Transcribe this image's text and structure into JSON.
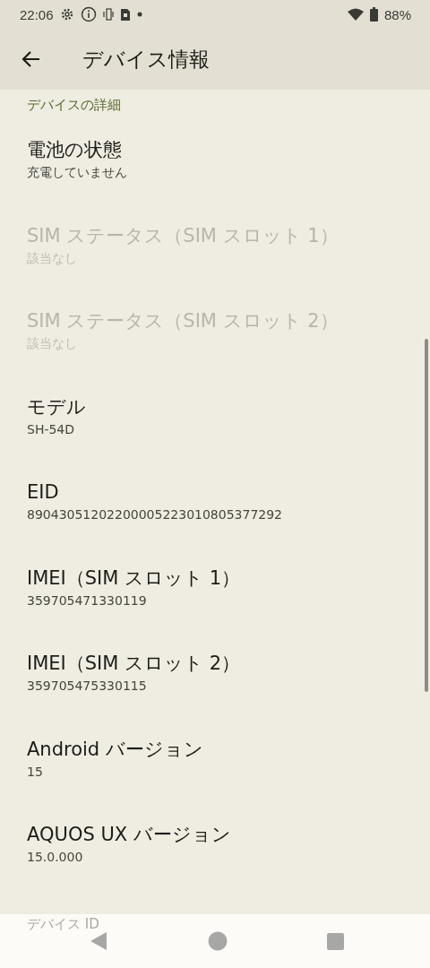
{
  "status_bar": {
    "time": "22:06",
    "battery": "88%"
  },
  "app_bar": {
    "title": "デバイス情報"
  },
  "section": {
    "title": "デバイスの詳細"
  },
  "items": [
    {
      "title": "電池の状態",
      "value": "充電していません",
      "disabled": false
    },
    {
      "title": "SIM ステータス（SIM スロット 1）",
      "value": "該当なし",
      "disabled": true
    },
    {
      "title": "SIM ステータス（SIM スロット 2）",
      "value": "該当なし",
      "disabled": true
    },
    {
      "title": "モデル",
      "value": "SH-54D",
      "disabled": false
    },
    {
      "title": "EID",
      "value": "89043051202200005223010805377292",
      "disabled": false
    },
    {
      "title": "IMEI（SIM スロット 1）",
      "value": "359705471330119",
      "disabled": false
    },
    {
      "title": "IMEI（SIM スロット 2）",
      "value": "359705475330115",
      "disabled": false
    },
    {
      "title": "Android バージョン",
      "value": "15",
      "disabled": false
    },
    {
      "title": "AQUOS UX バージョン",
      "value": "15.0.000",
      "disabled": false
    }
  ],
  "partly_hidden_item": {
    "title": "デバイス ID"
  }
}
